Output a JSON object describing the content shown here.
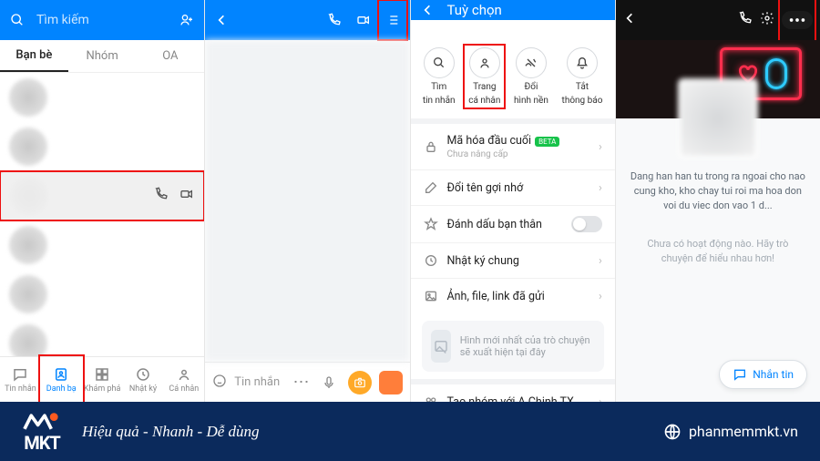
{
  "colors": {
    "primary": "#0184ff",
    "banner": "#0b2a5c",
    "highlight": "#e11"
  },
  "screen1": {
    "search_placeholder": "Tìm kiếm",
    "tabs": [
      "Bạn bè",
      "Nhóm",
      "OA"
    ],
    "bottom_nav": [
      "Tin nhắn",
      "Danh bạ",
      "Khám phá",
      "Nhật ký",
      "Cá nhân"
    ]
  },
  "screen2": {
    "input_placeholder": "Tin nhắn"
  },
  "screen3": {
    "title": "Tuỳ chọn",
    "actions": [
      {
        "label_line1": "Tìm",
        "label_line2": "tin nhắn"
      },
      {
        "label_line1": "Trang",
        "label_line2": "cá nhân"
      },
      {
        "label_line1": "Đổi",
        "label_line2": "hình nền"
      },
      {
        "label_line1": "Tắt",
        "label_line2": "thông báo"
      }
    ],
    "encrypt_title": "Mã hóa đầu cuối",
    "encrypt_badge": "BETA",
    "encrypt_sub": "Chưa nâng cấp",
    "rename": "Đổi tên gợi nhớ",
    "bestfriend": "Đánh dấu bạn thân",
    "diary": "Nhật ký chung",
    "media": "Ảnh, file, link đã gửi",
    "media_hint": "Hình mới nhất của trò chuyện sẽ xuất hiện tại đây",
    "create_group": "Tạo nhóm với A Chinh TX"
  },
  "screen4": {
    "bio": "Dang han han tu trong ra ngoai cho nao cung kho, kho chay tui roi ma hoa don voi du viec don vao 1 d...",
    "empty": "Chưa có hoạt động nào. Hãy trò chuyện để hiểu nhau hơn!",
    "msg_button": "Nhắn tin"
  },
  "banner": {
    "brand": "MKT",
    "slogan": "Hiệu quả - Nhanh - Dễ dùng",
    "site": "phanmemmkt.vn"
  }
}
